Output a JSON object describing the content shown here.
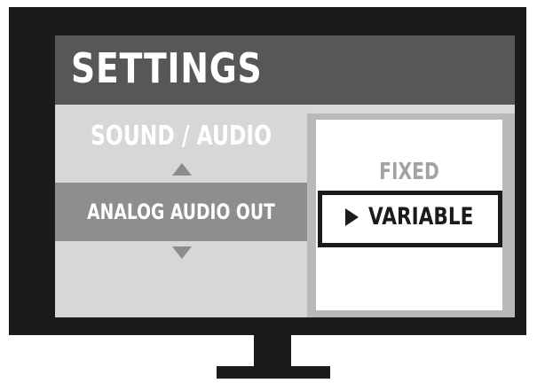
{
  "header": {
    "title": "SETTINGS"
  },
  "menu": {
    "category": "SOUND / AUDIO",
    "up_arrow_icon": "triangle-up",
    "down_arrow_icon": "triangle-down",
    "selected_item": "ANALOG AUDIO OUT"
  },
  "options": {
    "items": [
      {
        "label": "FIXED",
        "selected": false
      },
      {
        "label": "VARIABLE",
        "selected": true
      }
    ],
    "pointer_icon": "triangle-right"
  },
  "colors": {
    "bezel": "#1b1b1b",
    "header_bg": "#575757",
    "menu_bg": "#d7d7d7",
    "selected_row_bg": "#8e8e8e",
    "option_panel_border": "#b9b9b9",
    "inactive_option_text": "#a3a3a3",
    "active_option_text": "#1b1b1b"
  }
}
